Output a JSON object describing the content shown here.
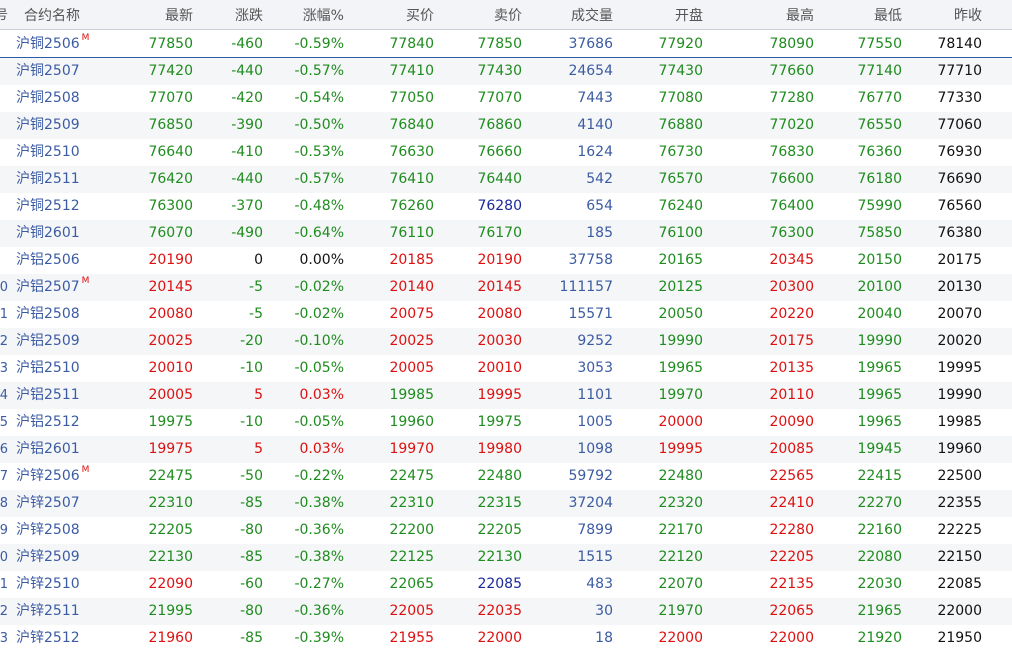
{
  "headers": {
    "idx": "号",
    "name": "合约名称",
    "last": "最新",
    "chg": "涨跌",
    "pct": "涨幅%",
    "bid": "买价",
    "ask": "卖价",
    "vol": "成交量",
    "open": "开盘",
    "high": "最高",
    "low": "最低",
    "prev": "昨收"
  },
  "colors": {
    "up": "#dd1010",
    "down": "#1e8c1e",
    "flat": "#111111",
    "neutral_blue": "#3b5ba3",
    "dark_blue": "#1a2a9c"
  },
  "rows": [
    {
      "idx": "",
      "name": "沪铜2506",
      "flag": "M",
      "last": "77850",
      "chg": "-460",
      "pct": "-0.59%",
      "bid": "77840",
      "ask": "77850",
      "vol": "37686",
      "open": "77920",
      "high": "78090",
      "low": "77550",
      "prev": "78140"
    },
    {
      "idx": "",
      "name": "沪铜2507",
      "flag": "",
      "last": "77420",
      "chg": "-440",
      "pct": "-0.57%",
      "bid": "77410",
      "ask": "77430",
      "vol": "24654",
      "open": "77430",
      "high": "77660",
      "low": "77140",
      "prev": "77710"
    },
    {
      "idx": "",
      "name": "沪铜2508",
      "flag": "",
      "last": "77070",
      "chg": "-420",
      "pct": "-0.54%",
      "bid": "77050",
      "ask": "77070",
      "vol": "7443",
      "open": "77080",
      "high": "77280",
      "low": "76770",
      "prev": "77330"
    },
    {
      "idx": "",
      "name": "沪铜2509",
      "flag": "",
      "last": "76850",
      "chg": "-390",
      "pct": "-0.50%",
      "bid": "76840",
      "ask": "76860",
      "vol": "4140",
      "open": "76880",
      "high": "77020",
      "low": "76550",
      "prev": "77060"
    },
    {
      "idx": "",
      "name": "沪铜2510",
      "flag": "",
      "last": "76640",
      "chg": "-410",
      "pct": "-0.53%",
      "bid": "76630",
      "ask": "76660",
      "vol": "1624",
      "open": "76730",
      "high": "76830",
      "low": "76360",
      "prev": "76930"
    },
    {
      "idx": "",
      "name": "沪铜2511",
      "flag": "",
      "last": "76420",
      "chg": "-440",
      "pct": "-0.57%",
      "bid": "76410",
      "ask": "76440",
      "vol": "542",
      "open": "76570",
      "high": "76600",
      "low": "76180",
      "prev": "76690"
    },
    {
      "idx": "",
      "name": "沪铜2512",
      "flag": "",
      "last": "76300",
      "chg": "-370",
      "pct": "-0.48%",
      "bid": "76260",
      "ask": "76280",
      "vol": "654",
      "open": "76240",
      "high": "76400",
      "low": "75990",
      "prev": "76560"
    },
    {
      "idx": "",
      "name": "沪铜2601",
      "flag": "",
      "last": "76070",
      "chg": "-490",
      "pct": "-0.64%",
      "bid": "76110",
      "ask": "76170",
      "vol": "185",
      "open": "76100",
      "high": "76300",
      "low": "75850",
      "prev": "76380"
    },
    {
      "idx": "",
      "name": "沪铝2506",
      "flag": "",
      "last": "20190",
      "chg": "0",
      "pct": "0.00%",
      "bid": "20185",
      "ask": "20190",
      "vol": "37758",
      "open": "20165",
      "high": "20345",
      "low": "20150",
      "prev": "20175"
    },
    {
      "idx": "0",
      "name": "沪铝2507",
      "flag": "M",
      "last": "20145",
      "chg": "-5",
      "pct": "-0.02%",
      "bid": "20140",
      "ask": "20145",
      "vol": "111157",
      "open": "20125",
      "high": "20300",
      "low": "20100",
      "prev": "20130"
    },
    {
      "idx": "1",
      "name": "沪铝2508",
      "flag": "",
      "last": "20080",
      "chg": "-5",
      "pct": "-0.02%",
      "bid": "20075",
      "ask": "20080",
      "vol": "15571",
      "open": "20050",
      "high": "20220",
      "low": "20040",
      "prev": "20070"
    },
    {
      "idx": "2",
      "name": "沪铝2509",
      "flag": "",
      "last": "20025",
      "chg": "-20",
      "pct": "-0.10%",
      "bid": "20025",
      "ask": "20030",
      "vol": "9252",
      "open": "19990",
      "high": "20175",
      "low": "19990",
      "prev": "20020"
    },
    {
      "idx": "3",
      "name": "沪铝2510",
      "flag": "",
      "last": "20010",
      "chg": "-10",
      "pct": "-0.05%",
      "bid": "20005",
      "ask": "20010",
      "vol": "3053",
      "open": "19965",
      "high": "20135",
      "low": "19965",
      "prev": "19995"
    },
    {
      "idx": "4",
      "name": "沪铝2511",
      "flag": "",
      "last": "20005",
      "chg": "5",
      "pct": "0.03%",
      "bid": "19985",
      "ask": "19995",
      "vol": "1101",
      "open": "19970",
      "high": "20110",
      "low": "19965",
      "prev": "19990"
    },
    {
      "idx": "5",
      "name": "沪铝2512",
      "flag": "",
      "last": "19975",
      "chg": "-10",
      "pct": "-0.05%",
      "bid": "19960",
      "ask": "19975",
      "vol": "1005",
      "open": "20000",
      "high": "20090",
      "low": "19965",
      "prev": "19985"
    },
    {
      "idx": "6",
      "name": "沪铝2601",
      "flag": "",
      "last": "19975",
      "chg": "5",
      "pct": "0.03%",
      "bid": "19970",
      "ask": "19980",
      "vol": "1098",
      "open": "19995",
      "high": "20085",
      "low": "19945",
      "prev": "19960"
    },
    {
      "idx": "7",
      "name": "沪锌2506",
      "flag": "M",
      "last": "22475",
      "chg": "-50",
      "pct": "-0.22%",
      "bid": "22475",
      "ask": "22480",
      "vol": "59792",
      "open": "22480",
      "high": "22565",
      "low": "22415",
      "prev": "22500"
    },
    {
      "idx": "8",
      "name": "沪锌2507",
      "flag": "",
      "last": "22310",
      "chg": "-85",
      "pct": "-0.38%",
      "bid": "22310",
      "ask": "22315",
      "vol": "37204",
      "open": "22320",
      "high": "22410",
      "low": "22270",
      "prev": "22355"
    },
    {
      "idx": "9",
      "name": "沪锌2508",
      "flag": "",
      "last": "22205",
      "chg": "-80",
      "pct": "-0.36%",
      "bid": "22200",
      "ask": "22205",
      "vol": "7899",
      "open": "22170",
      "high": "22280",
      "low": "22160",
      "prev": "22225"
    },
    {
      "idx": "0",
      "name": "沪锌2509",
      "flag": "",
      "last": "22130",
      "chg": "-85",
      "pct": "-0.38%",
      "bid": "22125",
      "ask": "22130",
      "vol": "1515",
      "open": "22120",
      "high": "22205",
      "low": "22080",
      "prev": "22150"
    },
    {
      "idx": "1",
      "name": "沪锌2510",
      "flag": "",
      "last": "22090",
      "chg": "-60",
      "pct": "-0.27%",
      "bid": "22065",
      "ask": "22085",
      "vol": "483",
      "open": "22070",
      "high": "22135",
      "low": "22030",
      "prev": "22085"
    },
    {
      "idx": "2",
      "name": "沪锌2511",
      "flag": "",
      "last": "21995",
      "chg": "-80",
      "pct": "-0.36%",
      "bid": "22005",
      "ask": "22035",
      "vol": "30",
      "open": "21970",
      "high": "22065",
      "low": "21965",
      "prev": "22000"
    },
    {
      "idx": "3",
      "name": "沪锌2512",
      "flag": "",
      "last": "21960",
      "chg": "-85",
      "pct": "-0.39%",
      "bid": "21955",
      "ask": "22000",
      "vol": "18",
      "open": "22000",
      "high": "22000",
      "low": "21920",
      "prev": "21950"
    }
  ]
}
